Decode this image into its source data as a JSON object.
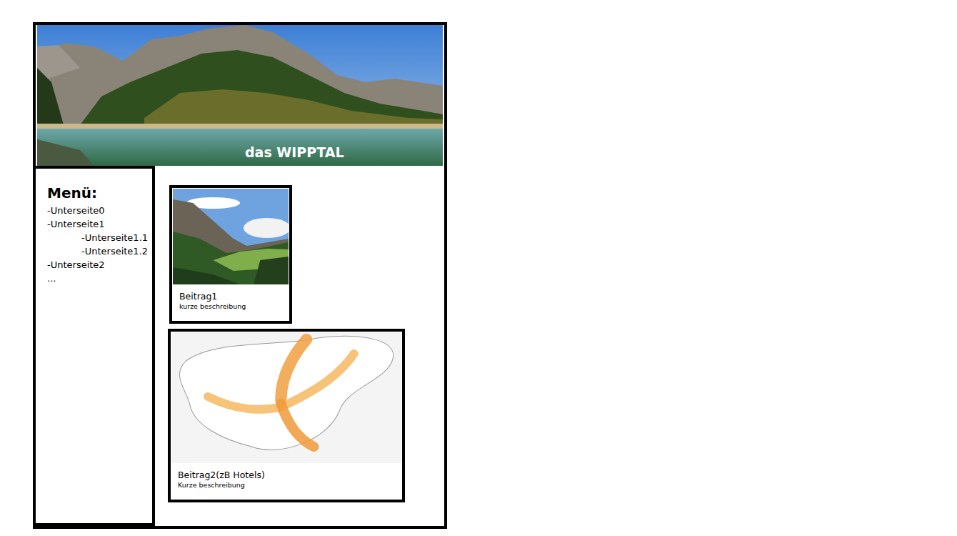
{
  "header": {
    "title": "das WIPPTAL"
  },
  "menu": {
    "title": "Menü:",
    "items": [
      {
        "label": "-Unterseite0",
        "kind": "main"
      },
      {
        "label": "-Unterseite1",
        "kind": "main"
      },
      {
        "label": "-Unterseite1.1",
        "kind": "sub"
      },
      {
        "label": "-Unterseite1.2",
        "kind": "sub"
      },
      {
        "label": "-Unterseite2",
        "kind": "main"
      },
      {
        "label": "...",
        "kind": "main"
      }
    ]
  },
  "posts": [
    {
      "title": "Beitrag1",
      "description": "kurze beschreibung",
      "kind": "photo"
    },
    {
      "title": "Beitrag2(zB Hotels)",
      "description": "Kurze beschreibung",
      "kind": "map"
    }
  ]
}
